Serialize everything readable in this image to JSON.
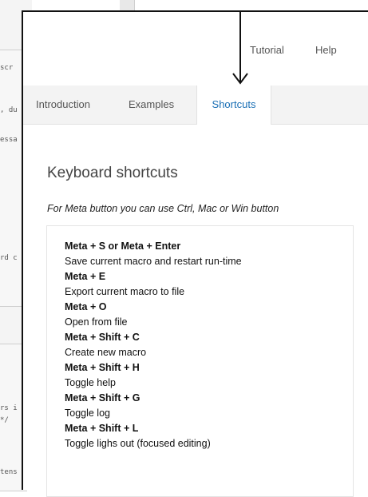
{
  "background": {
    "fragments": [
      "scr",
      ", du",
      "essa",
      "rd c",
      "rs i",
      "*/",
      "tens"
    ]
  },
  "nav": {
    "tutorial": "Tutorial",
    "help": "Help"
  },
  "tabs": [
    {
      "label": "Introduction",
      "active": false
    },
    {
      "label": "Examples",
      "active": false
    },
    {
      "label": "Shortcuts",
      "active": true
    }
  ],
  "content": {
    "heading": "Keyboard shortcuts",
    "note": "For Meta button you can use Ctrl, Mac or Win button",
    "shortcuts": [
      {
        "keys": "Meta + S or Meta + Enter",
        "desc": "Save current macro and restart run-time"
      },
      {
        "keys": "Meta + E",
        "desc": "Export current macro to file"
      },
      {
        "keys": "Meta + O",
        "desc": "Open from file"
      },
      {
        "keys": "Meta + Shift + C",
        "desc": "Create new macro"
      },
      {
        "keys": "Meta + Shift + H",
        "desc": "Toggle help"
      },
      {
        "keys": "Meta + Shift + G",
        "desc": "Toggle log"
      },
      {
        "keys": "Meta + Shift + L",
        "desc": "Toggle lighs out (focused editing)"
      }
    ]
  },
  "colors": {
    "active_tab": "#1a6fb5",
    "tabs_bg": "#f3f3f3",
    "arrow": "#111111"
  },
  "icons": {
    "pointer": "down-arrow-icon"
  }
}
